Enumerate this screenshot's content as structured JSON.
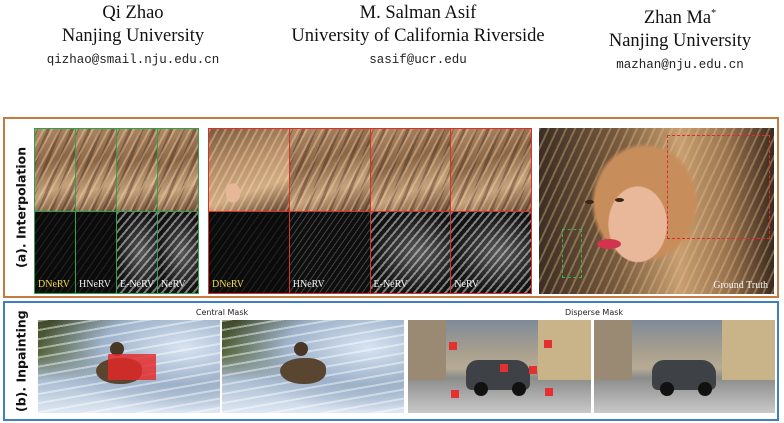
{
  "authors": [
    {
      "name": "Qi Zhao",
      "sup": "",
      "affiliation": "Nanjing University",
      "email": "qizhao@smail.nju.edu.cn"
    },
    {
      "name": "M. Salman Asif",
      "sup": "",
      "affiliation": "University of California Riverside",
      "email": "sasif@ucr.edu"
    },
    {
      "name": "Zhan Ma",
      "sup": "*",
      "affiliation": "Nanjing University",
      "email": "mazhan@nju.edu.cn"
    }
  ],
  "figure": {
    "interpolation": {
      "label": "(a). Interpolation",
      "small_labels": [
        "DNeRV",
        "HNeRV",
        "E-NeRV",
        "NeRV"
      ],
      "large_labels": [
        "DNeRV",
        "HNeRV",
        "E-NeRV",
        "NeRV"
      ],
      "ground_truth_label": "Ground Truth",
      "colors": {
        "panel_border": "#c47a41",
        "small_grid": "#2ea34e",
        "large_grid": "#d8322b",
        "highlight_label": "#f2d94e"
      }
    },
    "inpainting": {
      "label": "(b). Inpainting",
      "central_caption": "Central Mask",
      "disperse_caption": "Disperse Mask",
      "colors": {
        "panel_border": "#3f7fc1",
        "mask": "#e43030"
      }
    }
  }
}
